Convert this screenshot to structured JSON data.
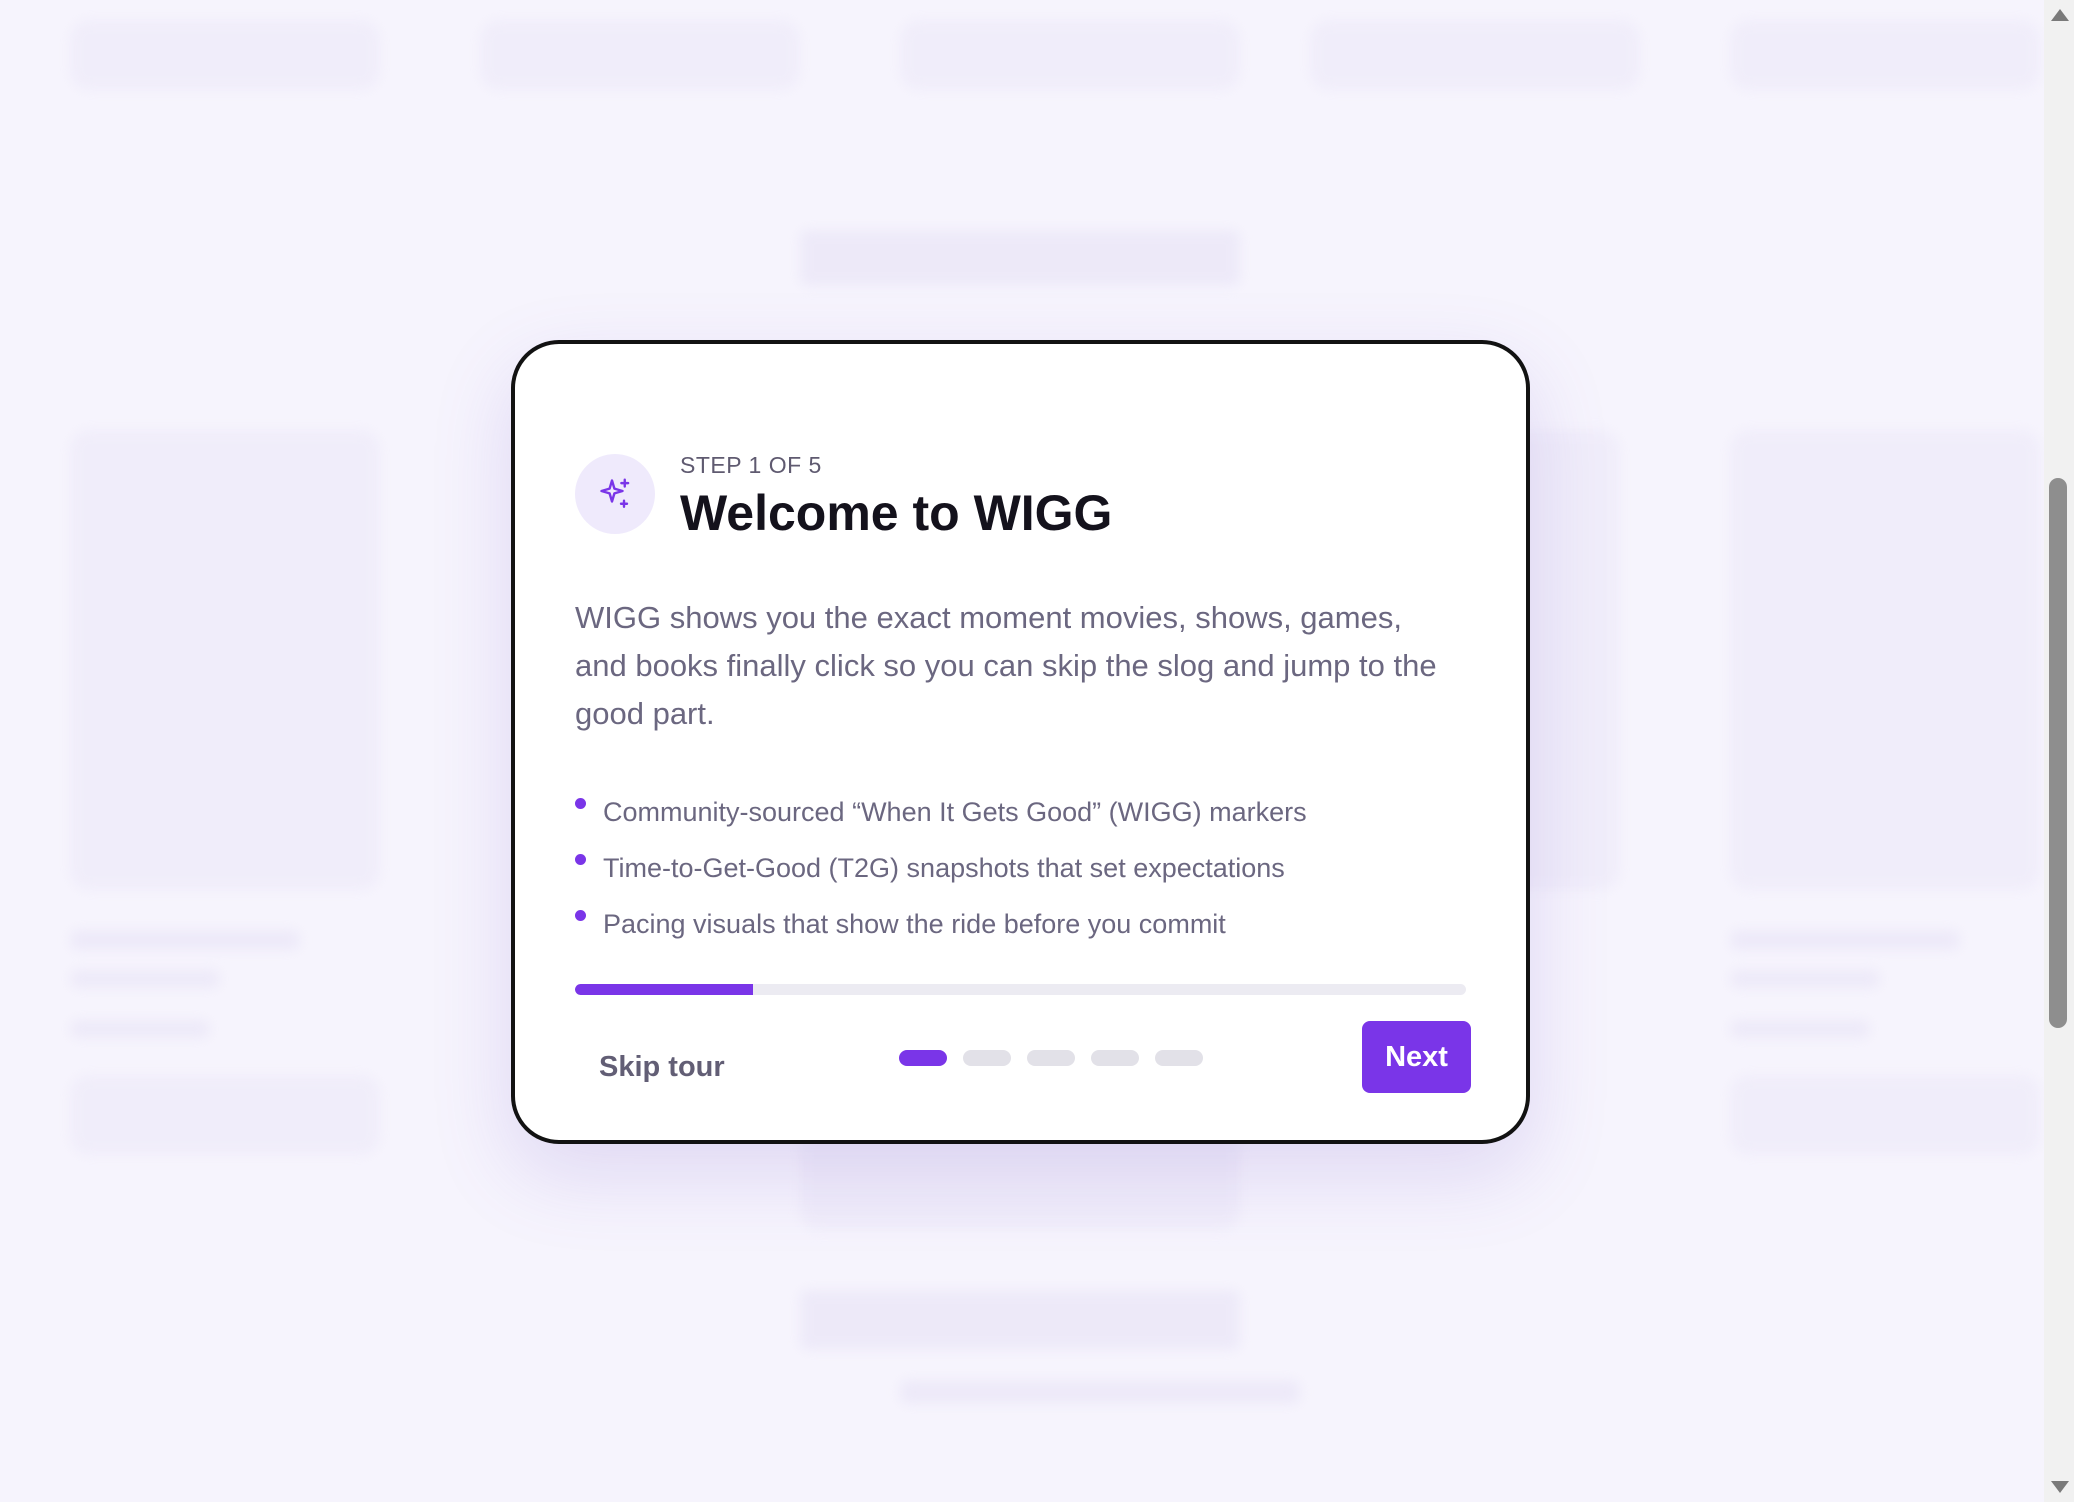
{
  "onboarding": {
    "step_label": "STEP 1 OF 5",
    "title": "Welcome to WIGG",
    "description": "WIGG shows you the exact moment movies, shows, games, and books finally click so you can skip the slog and jump to the good part.",
    "features": [
      "Community-sourced “When It Gets Good” (WIGG) markers",
      "Time-to-Get-Good (T2G) snapshots that set expectations",
      "Pacing visuals that show the ride before you commit"
    ],
    "progress": {
      "current_step": 1,
      "total_steps": 5,
      "fraction": 0.2
    },
    "skip_label": "Skip tour",
    "next_label": "Next",
    "icon": "sparkles-icon",
    "accent_color": "#7a35e8"
  }
}
